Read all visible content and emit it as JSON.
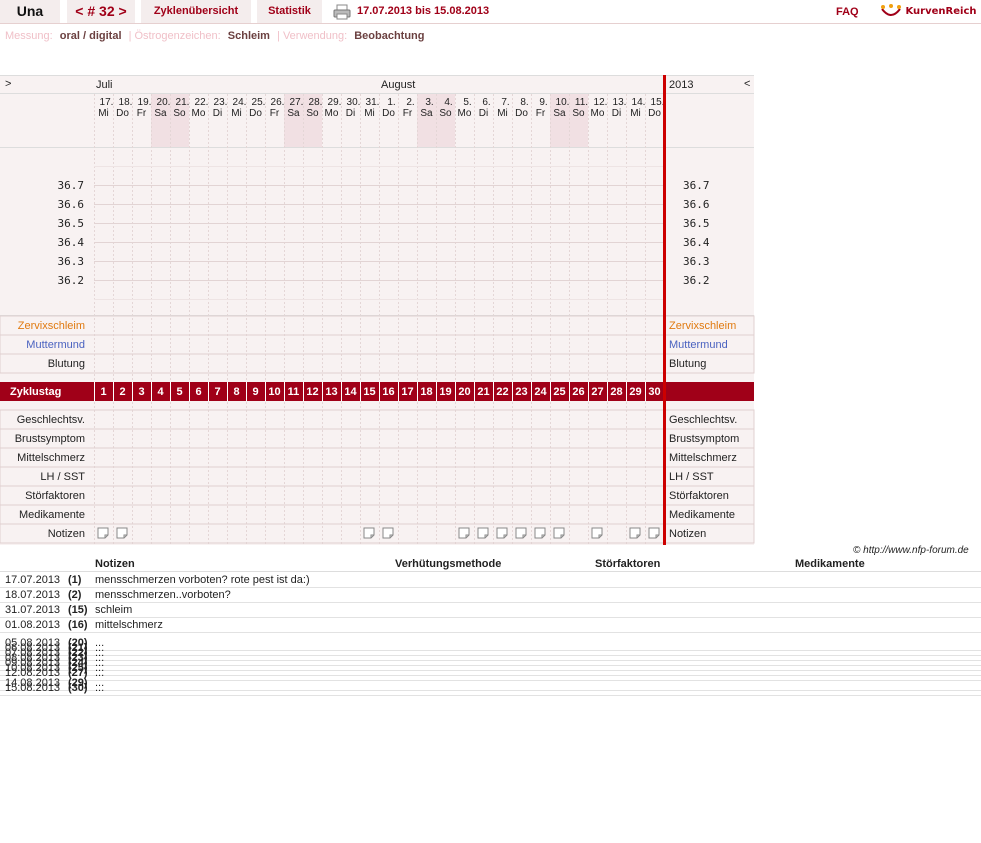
{
  "header": {
    "user": "Una",
    "cycle_nav": "< # 32 >",
    "tabs": [
      "Zyklenübersicht",
      "Statistik"
    ],
    "date_range": "17.07.2013 bis 15.08.2013",
    "faq": "FAQ",
    "logo": "KurvenReich"
  },
  "settings": {
    "measurement_label": "Messung:",
    "measurement": "oral / digital",
    "estrogen_label": "Östrogenzeichen:",
    "estrogen": "Schleim",
    "usage_label": "Verwendung:",
    "usage": "Beobachtung"
  },
  "chart": {
    "nav_left": ">",
    "nav_right": "<",
    "year": "2013",
    "months": [
      {
        "name": "Juli",
        "start": 0
      },
      {
        "name": "August",
        "start": 15
      }
    ],
    "days": [
      {
        "d": "17.",
        "w": "Mi"
      },
      {
        "d": "18.",
        "w": "Do"
      },
      {
        "d": "19.",
        "w": "Fr"
      },
      {
        "d": "20.",
        "w": "Sa"
      },
      {
        "d": "21.",
        "w": "So"
      },
      {
        "d": "22.",
        "w": "Mo"
      },
      {
        "d": "23.",
        "w": "Di"
      },
      {
        "d": "24.",
        "w": "Mi"
      },
      {
        "d": "25.",
        "w": "Do"
      },
      {
        "d": "26.",
        "w": "Fr"
      },
      {
        "d": "27.",
        "w": "Sa"
      },
      {
        "d": "28.",
        "w": "So"
      },
      {
        "d": "29.",
        "w": "Mo"
      },
      {
        "d": "30.",
        "w": "Di"
      },
      {
        "d": "31.",
        "w": "Mi"
      },
      {
        "d": "1.",
        "w": "Do"
      },
      {
        "d": "2.",
        "w": "Fr"
      },
      {
        "d": "3.",
        "w": "Sa"
      },
      {
        "d": "4.",
        "w": "So"
      },
      {
        "d": "5.",
        "w": "Mo"
      },
      {
        "d": "6.",
        "w": "Di"
      },
      {
        "d": "7.",
        "w": "Mi"
      },
      {
        "d": "8.",
        "w": "Do"
      },
      {
        "d": "9.",
        "w": "Fr"
      },
      {
        "d": "10.",
        "w": "Sa"
      },
      {
        "d": "11.",
        "w": "So"
      },
      {
        "d": "12.",
        "w": "Mo"
      },
      {
        "d": "13.",
        "w": "Di"
      },
      {
        "d": "14.",
        "w": "Mi"
      },
      {
        "d": "15.",
        "w": "Do"
      }
    ],
    "temps": [
      "36.7",
      "36.6",
      "36.5",
      "36.4",
      "36.3",
      "36.2"
    ],
    "rows_top": [
      {
        "label": "Zervixschleim",
        "color": "#e07a10"
      },
      {
        "label": "Muttermund",
        "color": "#4a62c0"
      },
      {
        "label": "Blutung",
        "color": "#222222"
      }
    ],
    "cycle_day_label": "Zyklustag",
    "rows_bottom": [
      "Geschlechtsv.",
      "Brustsymptom",
      "Mittelschmerz",
      "LH / SST",
      "Störfaktoren",
      "Medikamente",
      "Notizen"
    ],
    "note_days": [
      1,
      2,
      15,
      16,
      20,
      21,
      22,
      23,
      24,
      25,
      27,
      29,
      30
    ],
    "colors": {
      "accent": "#a00018",
      "grid_bg": "#f8f2f2",
      "weekend": "#f1e0e3"
    }
  },
  "footer": "© http://www.nfp-forum.de",
  "notes": {
    "headers": [
      "Notizen",
      "Verhütungsmethode",
      "Störfaktoren",
      "Medikamente"
    ],
    "rows": [
      {
        "date": "17.07.2013",
        "day": "(1)",
        "text": "mensschmerzen vorboten? rote pest ist da:)"
      },
      {
        "date": "18.07.2013",
        "day": "(2)",
        "text": "mensschmerzen..vorboten?"
      },
      {
        "date": "31.07.2013",
        "day": "(15)",
        "text": "schleim"
      },
      {
        "date": "01.08.2013",
        "day": "(16)",
        "text": "mittelschmerz"
      },
      {
        "date": "05.08.2013",
        "day": "(20)",
        "text": "..."
      },
      {
        "date": "06.08.2013",
        "day": "(21)",
        "text": "..."
      },
      {
        "date": "07.08.2013",
        "day": "(22)",
        "text": "..."
      },
      {
        "date": "08.08.2013",
        "day": "(23)",
        "text": "..."
      },
      {
        "date": "09.08.2013",
        "day": "(24)",
        "text": "..."
      },
      {
        "date": "10.08.2013",
        "day": "(25)",
        "text": "..."
      },
      {
        "date": "12.08.2013",
        "day": "(27)",
        "text": "..."
      },
      {
        "date": "14.08.2013",
        "day": "(29)",
        "text": "..."
      },
      {
        "date": "15.08.2013",
        "day": "(30)",
        "text": "..."
      }
    ]
  }
}
